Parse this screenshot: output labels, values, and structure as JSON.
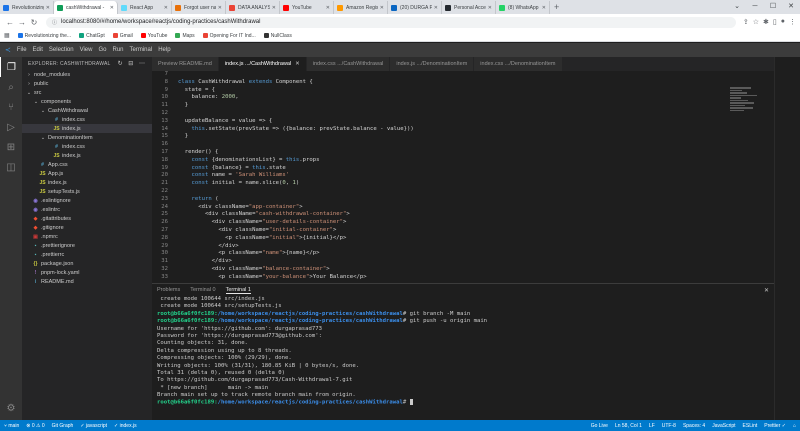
{
  "browser": {
    "tabs": [
      {
        "label": "Revolutionizing t",
        "color": "#1a73e8"
      },
      {
        "label": "cashWithdrawal -",
        "color": "#0f9d58"
      },
      {
        "label": "React App",
        "color": "#61dafb"
      },
      {
        "label": "Forgot user name",
        "color": "#e8710a"
      },
      {
        "label": "DATA ANALYST JI",
        "color": "#ea4335"
      },
      {
        "label": "YouTube",
        "color": "#ff0000"
      },
      {
        "label": "Amazon Registrat",
        "color": "#ff9900"
      },
      {
        "label": "(20) DURGA PRAS",
        "color": "#0a66c2"
      },
      {
        "label": "Personal Access T",
        "color": "#24292f"
      },
      {
        "label": "(8) WhatsApp",
        "color": "#25d366"
      }
    ],
    "url": "localhost:8080/#/home/workspace/reactjs/coding-practices/cashWithdrawal",
    "bookmarks": [
      {
        "label": "Revolutionizing the...",
        "color": "#1a73e8"
      },
      {
        "label": "ChatGpt",
        "color": "#10a37f"
      },
      {
        "label": "Gmail",
        "color": "#ea4335"
      },
      {
        "label": "YouTube",
        "color": "#ff0000"
      },
      {
        "label": "Maps",
        "color": "#34a853"
      },
      {
        "label": "Opening For IT Ind...",
        "color": "#ea4335"
      },
      {
        "label": "NullClass",
        "color": "#333333"
      }
    ]
  },
  "vscode": {
    "menu": [
      "File",
      "Edit",
      "Selection",
      "View",
      "Go",
      "Run",
      "Terminal",
      "Help"
    ],
    "explorer_title": "EXPLORER: CASHWITHDRAWAL",
    "tree": [
      {
        "label": "node_modules",
        "chev": "›",
        "icon": "",
        "color": "#cccccc",
        "indent": 0
      },
      {
        "label": "public",
        "chev": "›",
        "icon": "",
        "color": "#cccccc",
        "indent": 0
      },
      {
        "label": "src",
        "chev": "⌄",
        "icon": "",
        "color": "#cccccc",
        "indent": 0
      },
      {
        "label": "components",
        "chev": "⌄",
        "icon": "",
        "color": "#cccccc",
        "indent": 1
      },
      {
        "label": "CashWithdrawal",
        "chev": "⌄",
        "icon": "",
        "color": "#cccccc",
        "indent": 2
      },
      {
        "label": "index.css",
        "chev": "",
        "icon": "#",
        "color": "#519aba",
        "indent": 3
      },
      {
        "label": "index.js",
        "chev": "",
        "icon": "JS",
        "color": "#cbcb41",
        "indent": 3
      },
      {
        "label": "DenominationItem",
        "chev": "⌄",
        "icon": "",
        "color": "#cccccc",
        "indent": 2
      },
      {
        "label": "index.css",
        "chev": "",
        "icon": "#",
        "color": "#519aba",
        "indent": 3
      },
      {
        "label": "index.js",
        "chev": "",
        "icon": "JS",
        "color": "#cbcb41",
        "indent": 3
      },
      {
        "label": "App.css",
        "chev": "",
        "icon": "#",
        "color": "#519aba",
        "indent": 1
      },
      {
        "label": "App.js",
        "chev": "",
        "icon": "JS",
        "color": "#cbcb41",
        "indent": 1
      },
      {
        "label": "index.js",
        "chev": "",
        "icon": "JS",
        "color": "#cbcb41",
        "indent": 1
      },
      {
        "label": "setupTests.js",
        "chev": "",
        "icon": "JS",
        "color": "#cbcb41",
        "indent": 1
      },
      {
        "label": ".eslintignore",
        "chev": "",
        "icon": "◉",
        "color": "#8b76d8",
        "indent": 0
      },
      {
        "label": ".eslintrc",
        "chev": "",
        "icon": "◉",
        "color": "#8b76d8",
        "indent": 0
      },
      {
        "label": ".gitattributes",
        "chev": "",
        "icon": "◆",
        "color": "#f14e32",
        "indent": 0
      },
      {
        "label": ".gitignore",
        "chev": "",
        "icon": "◆",
        "color": "#f14e32",
        "indent": 0
      },
      {
        "label": ".npmrc",
        "chev": "",
        "icon": "▣",
        "color": "#cb3837",
        "indent": 0
      },
      {
        "label": ".prettierignore",
        "chev": "",
        "icon": "▪",
        "color": "#56b3b4",
        "indent": 0
      },
      {
        "label": ".prettierrc",
        "chev": "",
        "icon": "▪",
        "color": "#56b3b4",
        "indent": 0
      },
      {
        "label": "package.json",
        "chev": "",
        "icon": "{}",
        "color": "#cbcb41",
        "indent": 0
      },
      {
        "label": "pnpm-lock.yaml",
        "chev": "",
        "icon": "!",
        "color": "#a074c4",
        "indent": 0
      },
      {
        "label": "README.md",
        "chev": "",
        "icon": "i",
        "color": "#519aba",
        "indent": 0
      }
    ],
    "editor_tabs": [
      {
        "label": "Preview README.md",
        "active": false
      },
      {
        "label": "index.js .../CashWithdrawal",
        "active": true
      },
      {
        "label": "index.css .../CashWithdrawal",
        "active": false
      },
      {
        "label": "index.js .../DenominationItem",
        "active": false
      },
      {
        "label": "index.css .../DenominationItem",
        "active": false
      }
    ],
    "code_lines": [
      {
        "n": "7",
        "text": ""
      },
      {
        "n": "8",
        "text": "class CashWithdrawal extends Component {"
      },
      {
        "n": "9",
        "text": "  state = {"
      },
      {
        "n": "10",
        "text": "    balance: 2000,"
      },
      {
        "n": "11",
        "text": "  }"
      },
      {
        "n": "12",
        "text": ""
      },
      {
        "n": "13",
        "text": "  updateBalance = value => {"
      },
      {
        "n": "14",
        "text": "    this.setState(prevState => ({balance: prevState.balance - value}))"
      },
      {
        "n": "15",
        "text": "  }"
      },
      {
        "n": "16",
        "text": ""
      },
      {
        "n": "17",
        "text": "  render() {"
      },
      {
        "n": "18",
        "text": "    const {denominationsList} = this.props"
      },
      {
        "n": "19",
        "text": "    const {balance} = this.state"
      },
      {
        "n": "20",
        "text": "    const name = 'Sarah Williams'"
      },
      {
        "n": "21",
        "text": "    const initial = name.slice(0, 1)"
      },
      {
        "n": "22",
        "text": ""
      },
      {
        "n": "23",
        "text": "    return ("
      },
      {
        "n": "24",
        "text": "      <div className=\"app-container\">"
      },
      {
        "n": "25",
        "text": "        <div className=\"cash-withdrawal-container\">"
      },
      {
        "n": "26",
        "text": "          <div className=\"user-details-container\">"
      },
      {
        "n": "27",
        "text": "            <div className=\"initial-container\">"
      },
      {
        "n": "28",
        "text": "              <p className=\"initial\">{initial}</p>"
      },
      {
        "n": "29",
        "text": "            </div>"
      },
      {
        "n": "30",
        "text": "            <p className=\"name\">{name}</p>"
      },
      {
        "n": "31",
        "text": "          </div>"
      },
      {
        "n": "32",
        "text": "          <div className=\"balance-container\">"
      },
      {
        "n": "33",
        "text": "            <p className=\"your-balance\">Your Balance</p>"
      }
    ],
    "panel_tabs": [
      "Problems",
      "Terminal 0",
      "Terminal 1"
    ],
    "terminal_lines": [
      {
        "prompt": "",
        "path": "",
        "cmd": " create mode 100644 src/index.js"
      },
      {
        "prompt": "",
        "path": "",
        "cmd": " create mode 100644 src/setupTests.js"
      },
      {
        "prompt": "root@b66a6f0fc189",
        "path": "/home/workspace/reactjs/coding-practices/cashWithdrawal",
        "cmd": "# git branch -M main"
      },
      {
        "prompt": "root@b66a6f0fc189",
        "path": "/home/workspace/reactjs/coding-practices/cashWithdrawal",
        "cmd": "# git push -u origin main"
      },
      {
        "prompt": "",
        "path": "",
        "cmd": "Username for 'https://github.com': durgaprasad773"
      },
      {
        "prompt": "",
        "path": "",
        "cmd": "Password for 'https://durgaprasad773@github.com':"
      },
      {
        "prompt": "",
        "path": "",
        "cmd": "Counting objects: 31, done."
      },
      {
        "prompt": "",
        "path": "",
        "cmd": "Delta compression using up to 8 threads."
      },
      {
        "prompt": "",
        "path": "",
        "cmd": "Compressing objects: 100% (29/29), done."
      },
      {
        "prompt": "",
        "path": "",
        "cmd": "Writing objects: 100% (31/31), 180.85 KiB | 0 bytes/s, done."
      },
      {
        "prompt": "",
        "path": "",
        "cmd": "Total 31 (delta 0), reused 0 (delta 0)"
      },
      {
        "prompt": "",
        "path": "",
        "cmd": "To https://github.com/durgaprasad773/Cash-Withdrawal-7.git"
      },
      {
        "prompt": "",
        "path": "",
        "cmd": " * [new branch]      main -> main"
      },
      {
        "prompt": "",
        "path": "",
        "cmd": "Branch main set up to track remote branch main from origin."
      },
      {
        "prompt": "root@b66a6f0fc189",
        "path": "/home/workspace/reactjs/coding-practices/cashWithdrawal",
        "cmd": "# "
      }
    ],
    "status_left": [
      "⑂ main",
      "⊗ 0 ⚠ 0",
      "Git Graph",
      "✓ javascript",
      "✓ index.js"
    ],
    "status_right": [
      "Go Live",
      "Ln 58, Col 1",
      "LF",
      "UTF-8",
      "Spaces: 4",
      "JavaScript",
      "ESLint",
      "Prettier ✓",
      "⌂"
    ]
  }
}
